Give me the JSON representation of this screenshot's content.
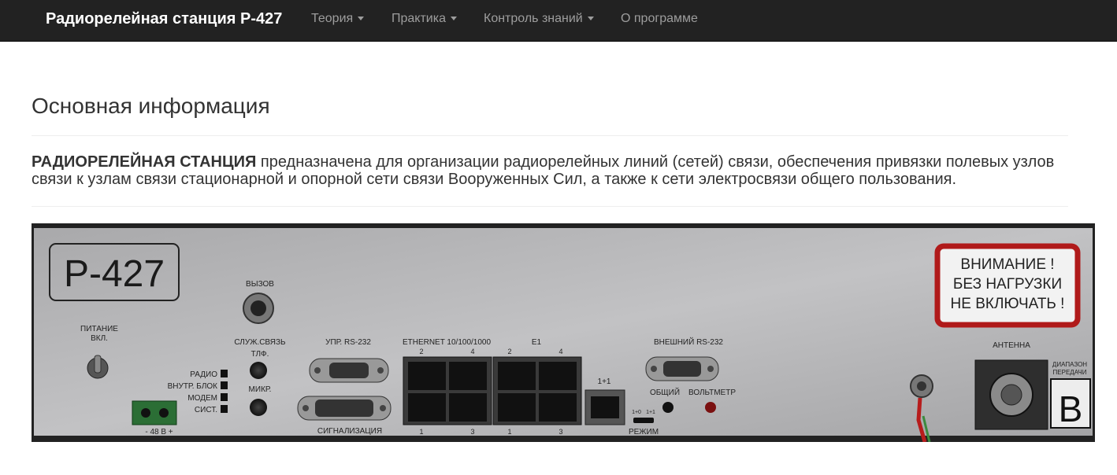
{
  "navbar": {
    "brand": "Радиорелейная станция Р-427",
    "items": [
      {
        "label": "Теория",
        "dropdown": true
      },
      {
        "label": "Практика",
        "dropdown": true
      },
      {
        "label": "Контроль знаний",
        "dropdown": true
      },
      {
        "label": "О программе",
        "dropdown": false
      }
    ]
  },
  "main": {
    "title": "Основная информация",
    "lead_bold": "РАДИОРЕЛЕЙНАЯ СТАНЦИЯ",
    "lead_text": " предназначена для организации радиорелейных линий (сетей) связи, обеспечения привязки полевых узлов связи к узлам связи стационарной и опорной сети связи Вооруженных Сил, а также к сети электросвязи общего пользования."
  },
  "panel": {
    "model": "Р-427",
    "warning": [
      "ВНИМАНИЕ !",
      "БЕЗ НАГРУЗКИ",
      "НЕ ВКЛЮЧАТЬ !"
    ],
    "power": [
      "ПИТАНИЕ",
      "ВКЛ."
    ],
    "call": "ВЫЗОВ",
    "service": "СЛУЖ.СВЯЗЬ",
    "phone": "ТЛФ.",
    "mic": "МИКР.",
    "leds": [
      "РАДИО",
      "ВНУТР. БЛОК",
      "МОДЕМ",
      "СИСТ."
    ],
    "supply": "- 48 В +",
    "rs232_ctrl": "УПР. RS-232",
    "signaling": "СИГНАЛИЗАЦИЯ",
    "ethernet": "ETHERNET 10/100/1000",
    "e1": "E1",
    "port_top": [
      "2",
      "4"
    ],
    "port_bottom": [
      "1",
      "3"
    ],
    "one_plus_one": "1+1",
    "mode_labels": [
      "1+0",
      "1+1"
    ],
    "mode": "РЕЖИМ",
    "rs232_ext": "ВНЕШНИЙ RS-232",
    "common": "ОБЩИЙ",
    "voltmeter": "ВОЛЬТМЕТР",
    "antenna": "АНТЕННА",
    "range": [
      "ДИАПАЗОН",
      "ПЕРЕДАЧИ"
    ],
    "range_letter": "B"
  }
}
